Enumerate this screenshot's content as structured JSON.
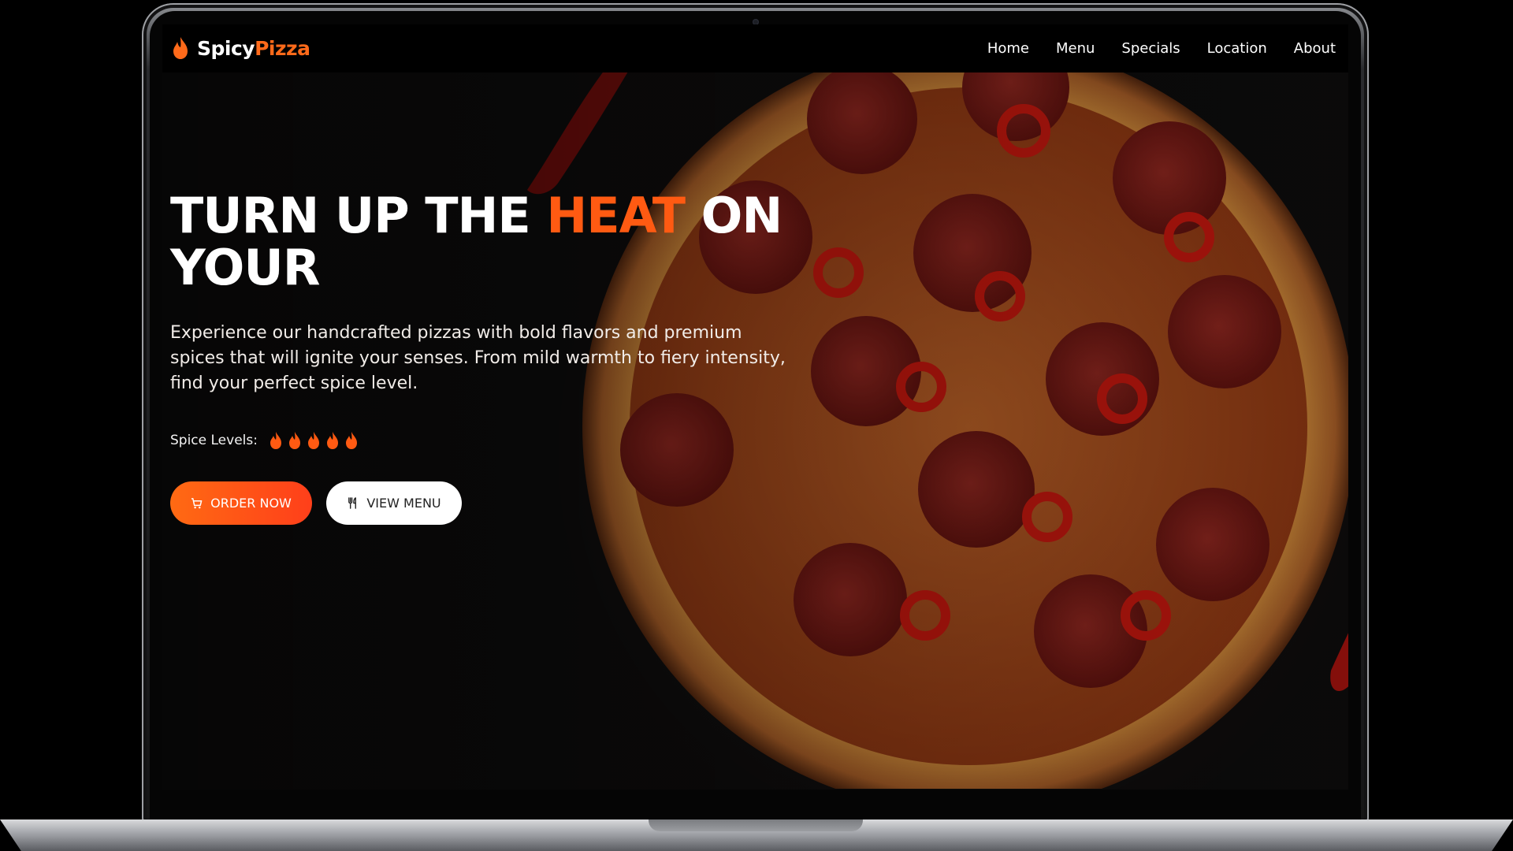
{
  "brand": {
    "name_part1": "Spicy",
    "name_part2": "Pizza",
    "accent_color": "#ff6a1a",
    "logo_icon": "flame-icon"
  },
  "nav": {
    "items": [
      {
        "label": "Home"
      },
      {
        "label": "Menu"
      },
      {
        "label": "Specials"
      },
      {
        "label": "Location"
      },
      {
        "label": "About"
      }
    ]
  },
  "hero": {
    "headline_part1": "TURN UP THE ",
    "headline_accent": "HEAT",
    "headline_part2": " ON YOUR",
    "subtext": "Experience our handcrafted pizzas with bold flavors and premium spices that will ignite your senses. From mild warmth to fiery intensity, find your perfect spice level.",
    "spice_label": "Spice Levels:",
    "spice_level_count": 5,
    "spice_icon": "flame-icon",
    "order_button": {
      "label": "ORDER NOW",
      "icon": "cart-icon",
      "color": "#ff5a12"
    },
    "menu_button": {
      "label": "VIEW MENU",
      "icon": "utensils-icon"
    }
  }
}
